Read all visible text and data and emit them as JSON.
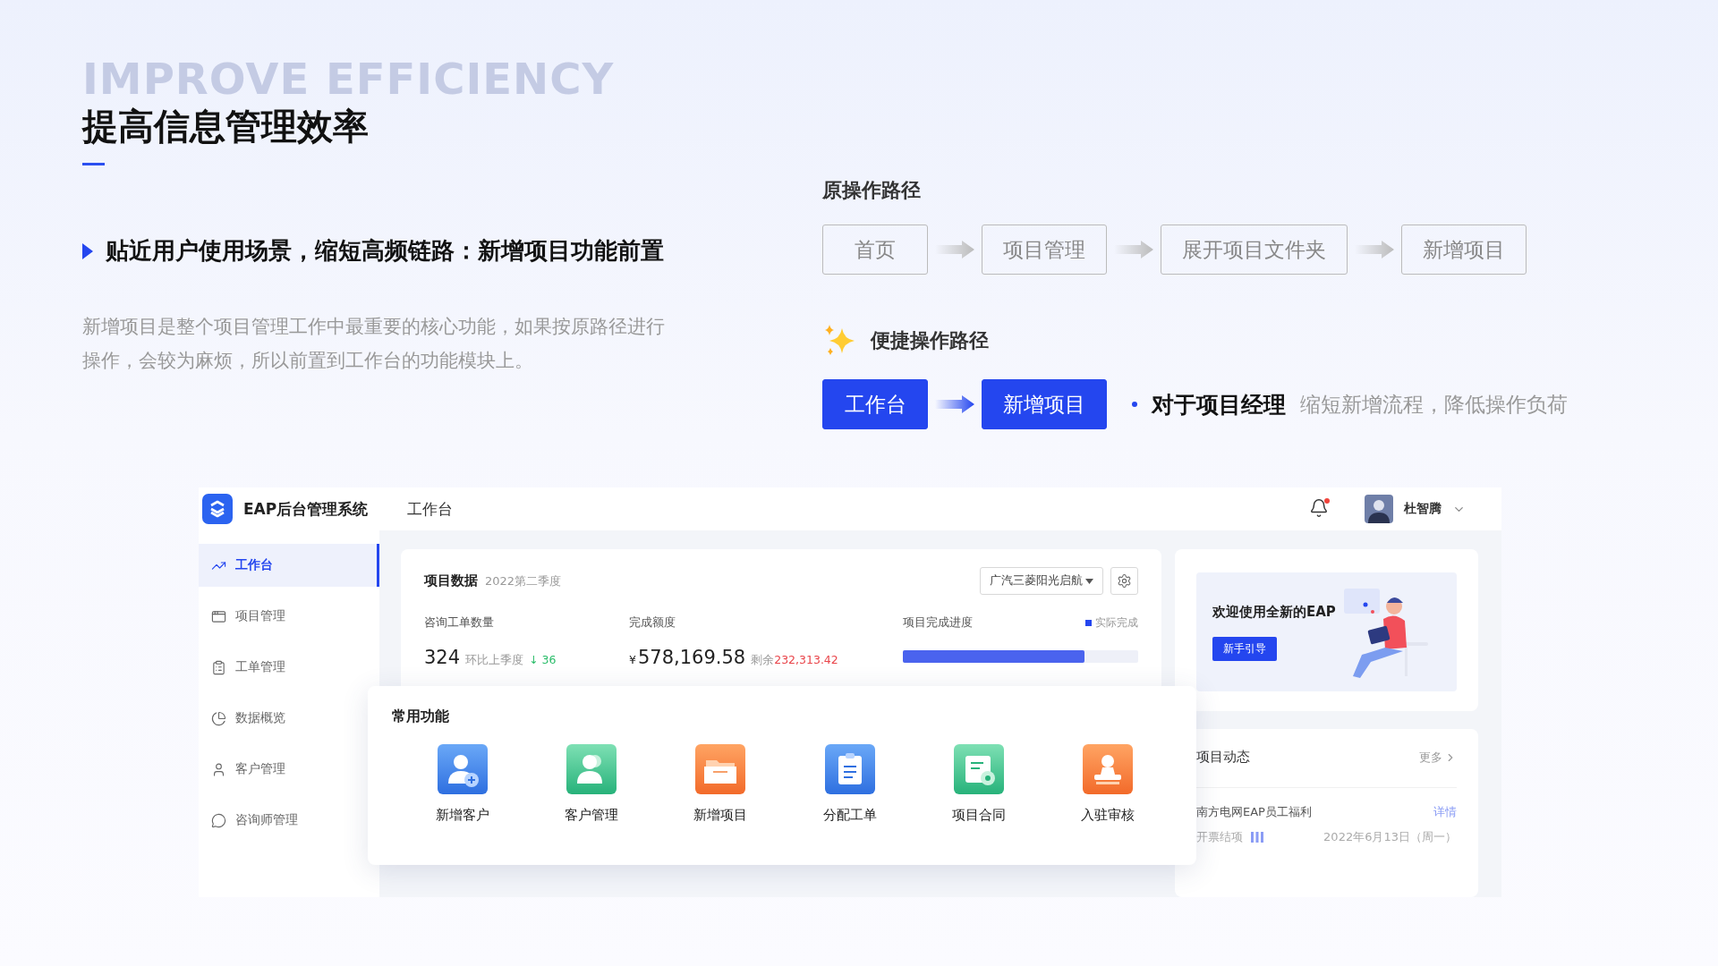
{
  "background_text": "IMPROVE EFFICIENCY",
  "title": "提高信息管理效率",
  "headline": "贴近用户使用场景，缩短高频链路：新增项目功能前置",
  "description": "新增项目是整个项目管理工作中最重要的核心功能，如果按原路径进行操作，会较为麻烦，所以前置到工作台的功能模块上。",
  "original_path": {
    "title": "原操作路径",
    "steps": [
      "首页",
      "项目管理",
      "展开项目文件夹",
      "新增项目"
    ]
  },
  "quick_path": {
    "title": "便捷操作路径",
    "steps": [
      "工作台",
      "新增项目"
    ],
    "note_label": "对于项目经理",
    "note_text": "缩短新增流程，降低操作负荷"
  },
  "app": {
    "logo_text": "EAP后台管理系统",
    "nav_title": "工作台",
    "has_unread": true,
    "user": {
      "name": "杜智腾"
    },
    "sidebar": [
      {
        "label": "工作台",
        "kind": "chart",
        "selected": true
      },
      {
        "label": "项目管理",
        "kind": "window",
        "selected": false
      },
      {
        "label": "工单管理",
        "kind": "clipboard",
        "selected": false
      },
      {
        "label": "数据概览",
        "kind": "pie",
        "selected": false
      },
      {
        "label": "客户管理",
        "kind": "user",
        "selected": false
      },
      {
        "label": "咨询师管理",
        "kind": "chat",
        "selected": false
      }
    ],
    "project_data": {
      "title": "项目数据",
      "period": "2022第二季度",
      "filter": "广汽三菱阳光启航",
      "orders": {
        "label": "咨询工单数量",
        "value": "324",
        "compare_label": "环比上季度",
        "change": "↓ 36"
      },
      "amount": {
        "label": "完成额度",
        "currency": "¥",
        "value": "578,169.58",
        "remaining_label": "剩余",
        "remaining_value": "232,313.42"
      },
      "progress": {
        "label": "项目完成进度",
        "legend": "实际完成",
        "level": 0.77
      }
    },
    "welcome": {
      "title": "欢迎使用全新的EAP",
      "button": "新手引导"
    },
    "activity": {
      "title": "项目动态",
      "more": "更多",
      "items": [
        {
          "title": "南方电网EAP员工福利",
          "link": "详情",
          "status": "开票结项",
          "date": "2022年6月13日（周一）"
        }
      ]
    },
    "shortcuts": {
      "title": "常用功能",
      "items": [
        {
          "label": "新增客户",
          "kind": "add-customer"
        },
        {
          "label": "客户管理",
          "kind": "customers"
        },
        {
          "label": "新增项目",
          "kind": "folder"
        },
        {
          "label": "分配工单",
          "kind": "clipboard"
        },
        {
          "label": "项目合同",
          "kind": "contract"
        },
        {
          "label": "入驻审核",
          "kind": "stamp"
        }
      ]
    }
  }
}
